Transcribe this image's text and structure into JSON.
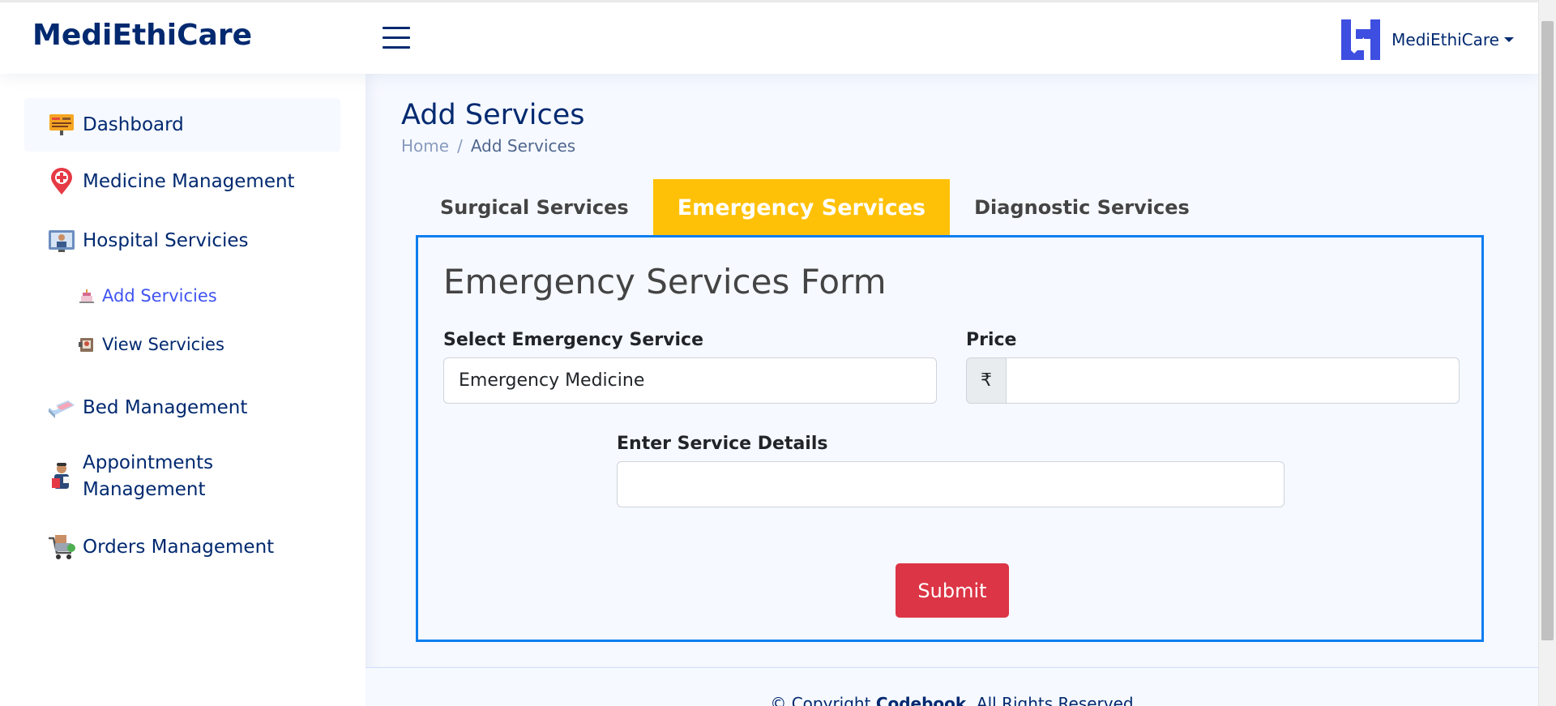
{
  "app": {
    "brand": "MediEthiCare"
  },
  "header": {
    "profile_name": "MediEthiCare"
  },
  "sidebar": {
    "items": [
      {
        "label": "Dashboard",
        "icon": "dashboard-board-icon"
      },
      {
        "label": "Medicine Management",
        "icon": "medical-pin-icon"
      },
      {
        "label": "Hospital Servicies",
        "icon": "doctor-screen-icon"
      },
      {
        "label": "Bed Management",
        "icon": "bed-icon"
      },
      {
        "label": "Appointments",
        "label2": "Management",
        "icon": "doctor-appointment-icon"
      },
      {
        "label": "Orders Management",
        "icon": "shopping-cart-icon"
      }
    ],
    "sub_items": [
      {
        "label": "Add Servicies",
        "icon": "cake-icon"
      },
      {
        "label": "View Servicies",
        "icon": "folder-photo-icon"
      }
    ]
  },
  "page": {
    "title": "Add Services",
    "breadcrumb": {
      "home": "Home",
      "separator": "/",
      "current": "Add Services"
    }
  },
  "tabs": [
    {
      "label": "Surgical Services"
    },
    {
      "label": "Emergency Services",
      "active": true
    },
    {
      "label": "Diagnostic Services"
    }
  ],
  "form": {
    "title": "Emergency Services Form",
    "service_label": "Select Emergency Service",
    "service_value": "Emergency Medicine",
    "price_label": "Price",
    "currency_symbol": "₹",
    "price_value": "",
    "details_label": "Enter Service Details",
    "details_value": "",
    "submit_label": "Submit"
  },
  "footer": {
    "prefix": "© Copyright",
    "company": "Codebook",
    "suffix": ". All Rights Reserved"
  },
  "colors": {
    "primary_navy": "#012970",
    "active_tab": "#ffc107",
    "submit": "#dc3545",
    "form_border": "#0d7ef0",
    "link": "#4154f1"
  }
}
